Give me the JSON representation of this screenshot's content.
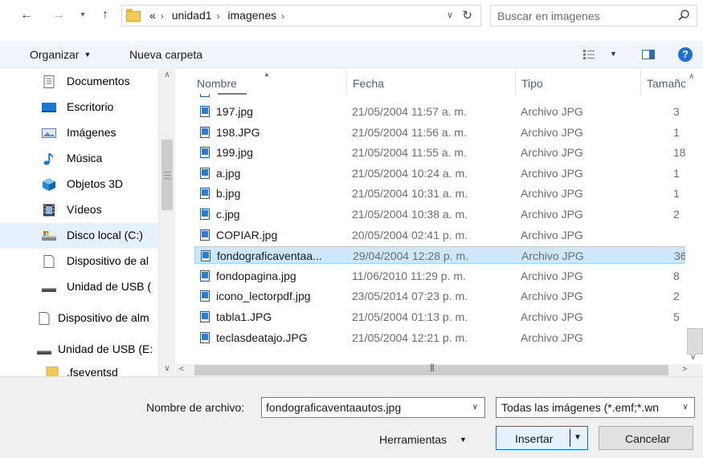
{
  "address": {
    "crumbs": [
      "«",
      "unidad1",
      "imagenes"
    ],
    "search_placeholder": "Buscar en imagenes"
  },
  "toolbar": {
    "organize_label": "Organizar",
    "new_folder_label": "Nueva carpeta",
    "help_label": "?"
  },
  "navpane": {
    "items": [
      {
        "label": "Documentos",
        "icon": "documents-icon"
      },
      {
        "label": "Escritorio",
        "icon": "desktop-icon"
      },
      {
        "label": "Imágenes",
        "icon": "pictures-icon"
      },
      {
        "label": "Música",
        "icon": "music-icon"
      },
      {
        "label": "Objetos 3D",
        "icon": "objects3d-icon"
      },
      {
        "label": "Vídeos",
        "icon": "videos-icon"
      },
      {
        "label": "Disco local (C:)",
        "icon": "local-disk-icon",
        "selected": true
      },
      {
        "label": "Dispositivo de al",
        "icon": "storage-device-icon"
      },
      {
        "label": "Unidad de USB (",
        "icon": "usb-drive-icon"
      },
      {
        "label": "Dispositivo de alm",
        "icon": "storage-device-icon"
      },
      {
        "label": "Unidad de USB (E:",
        "icon": "usb-drive-icon"
      },
      {
        "label": ".fseventsd",
        "icon": "folder-icon"
      }
    ]
  },
  "filelist": {
    "columns": [
      "Nombre",
      "Fecha",
      "Tipo",
      "Tamaño"
    ],
    "rows": [
      {
        "name": "197.jpg",
        "date": "21/05/2004 11:57 a. m.",
        "type": "Archivo JPG",
        "size": "3"
      },
      {
        "name": "198.JPG",
        "date": "21/05/2004 11:56 a. m.",
        "type": "Archivo JPG",
        "size": "1"
      },
      {
        "name": "199.jpg",
        "date": "21/05/2004 11:55 a. m.",
        "type": "Archivo JPG",
        "size": "18"
      },
      {
        "name": "a.jpg",
        "date": "21/05/2004 10:24 a. m.",
        "type": "Archivo JPG",
        "size": "1"
      },
      {
        "name": "b.jpg",
        "date": "21/05/2004 10:31 a. m.",
        "type": "Archivo JPG",
        "size": "1"
      },
      {
        "name": "c.jpg",
        "date": "21/05/2004 10:38 a. m.",
        "type": "Archivo JPG",
        "size": "2"
      },
      {
        "name": "COPIAR.jpg",
        "date": "20/05/2004 02:41 p. m.",
        "type": "Archivo JPG",
        "size": ""
      },
      {
        "name": "fondograficaventaa...",
        "date": "29/04/2004 12:28 p. m.",
        "type": "Archivo JPG",
        "size": "36",
        "selected": true
      },
      {
        "name": "fondopagina.jpg",
        "date": "11/06/2010 11:29 p. m.",
        "type": "Archivo JPG",
        "size": "8"
      },
      {
        "name": "icono_lectorpdf.jpg",
        "date": "23/05/2014 07:23 p. m.",
        "type": "Archivo JPG",
        "size": "2"
      },
      {
        "name": "tabla1.JPG",
        "date": "21/05/2004 01:13 p. m.",
        "type": "Archivo JPG",
        "size": "5"
      },
      {
        "name": "teclasdeatajo.JPG",
        "date": "21/05/2004 12:21 p. m.",
        "type": "Archivo JPG",
        "size": ""
      }
    ]
  },
  "bottom": {
    "filename_label": "Nombre de archivo:",
    "filename_value": "fondograficaventaautos.jpg",
    "filter_value": "Todas las imágenes (*.emf;*.wn",
    "tools_label": "Herramientas",
    "insert_label": "Insertar",
    "cancel_label": "Cancelar"
  }
}
